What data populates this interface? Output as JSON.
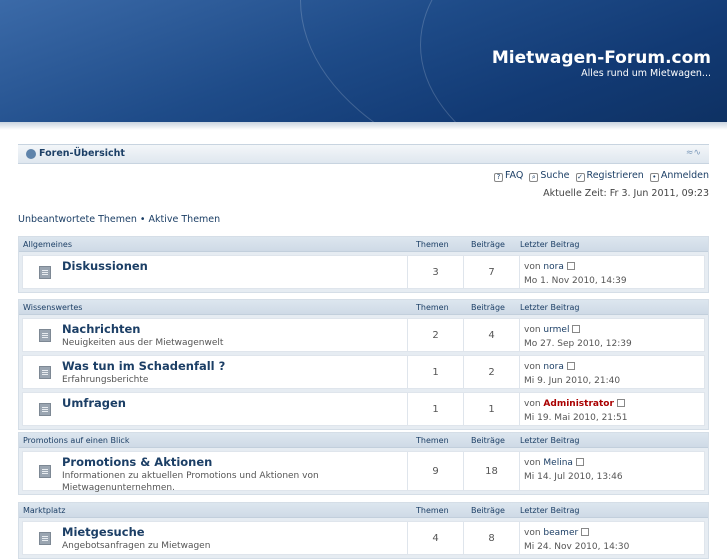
{
  "site": {
    "title": "Mietwagen-Forum.com",
    "description": "Alles rund um Mietwagen..."
  },
  "navbar": {
    "home": "Foren-Übersicht"
  },
  "toplinks": {
    "faq": "FAQ",
    "search": "Suche",
    "register": "Registrieren",
    "login": "Anmelden"
  },
  "time": "Aktuelle Zeit: Fr 3. Jun 2011, 09:23",
  "unlinks": {
    "unanswered": "Unbeantwortete Themen",
    "sep": "•",
    "active": "Aktive Themen"
  },
  "columns": {
    "topics": "Themen",
    "posts": "Beiträge",
    "last": "Letzter Beitrag"
  },
  "categories": [
    {
      "name": "Allgemeines",
      "forums": [
        {
          "title": "Diskussionen",
          "desc": "",
          "topics": "3",
          "posts": "7",
          "by_prefix": "von",
          "by": "nora",
          "date": "Mo 1. Nov 2010, 14:39"
        }
      ]
    },
    {
      "name": "Wissenswertes",
      "forums": [
        {
          "title": "Nachrichten",
          "desc": "Neuigkeiten aus der Mietwagenwelt",
          "topics": "2",
          "posts": "4",
          "by_prefix": "von",
          "by": "urmel",
          "date": "Mo 27. Sep 2010, 12:39"
        },
        {
          "title": "Was tun im Schadenfall ?",
          "desc": "Erfahrungsberichte",
          "topics": "1",
          "posts": "2",
          "by_prefix": "von",
          "by": "nora",
          "date": "Mi 9. Jun 2010, 21:40"
        },
        {
          "title": "Umfragen",
          "desc": "",
          "topics": "1",
          "posts": "1",
          "by_prefix": "von",
          "by": "Administrator",
          "date": "Mi 19. Mai 2010, 21:51"
        }
      ]
    },
    {
      "name": "Promotions auf einen Blick",
      "forums": [
        {
          "title": "Promotions & Aktionen",
          "desc": "Informationen zu aktuellen Promotions und Aktionen von Mietwagenunternehmen.",
          "topics": "9",
          "posts": "18",
          "by_prefix": "von",
          "by": "Melina",
          "date": "Mi 14. Jul 2010, 13:46"
        }
      ]
    },
    {
      "name": "Marktplatz",
      "forums": [
        {
          "title": "Mietgesuche",
          "desc": "Angebotsanfragen zu Mietwagen",
          "topics": "4",
          "posts": "8",
          "by_prefix": "von",
          "by": "beamer",
          "date": "Mi 24. Nov 2010, 14:30"
        }
      ]
    }
  ]
}
